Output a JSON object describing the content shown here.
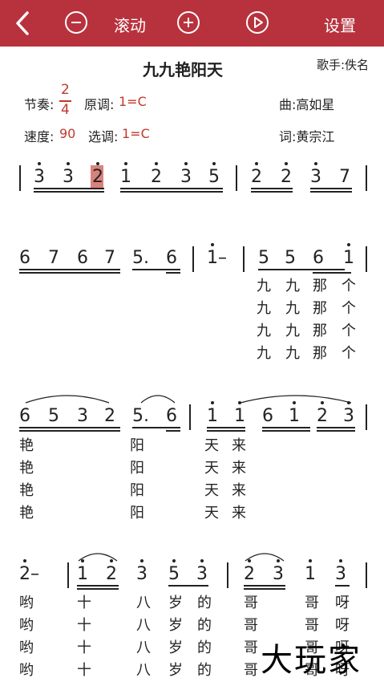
{
  "header": {
    "scroll_label": "滚动",
    "settings_label": "设置"
  },
  "song": {
    "title": "九九艳阳天",
    "singer": "歌手:佚名",
    "rhythm_label": "节奏:",
    "time_sig_top": "2",
    "time_sig_bottom": "4",
    "orig_key_label": "原调:",
    "orig_key": "1=C",
    "composer": "曲:高如星",
    "tempo_label": "速度:",
    "tempo": "90",
    "sel_key_label": "选调:",
    "sel_key": "1=C",
    "lyricist": "词:黄宗江"
  },
  "notes": {
    "r1": [
      "3",
      "3",
      "2",
      "1",
      "2",
      "3",
      "5",
      "2",
      "2",
      "3",
      "7"
    ],
    "r2": [
      "6",
      "7",
      "6",
      "7",
      "5.",
      "6",
      "1–",
      "5",
      "5",
      "6",
      "1"
    ],
    "r3": [
      "6",
      "5",
      "3",
      "2",
      "5.",
      "6",
      "1",
      "1",
      "6",
      "1",
      "2",
      "3"
    ],
    "r4": [
      "2–",
      "1",
      "2",
      "3",
      "5",
      "3",
      "2",
      "3",
      "1",
      "3"
    ]
  },
  "lyrics": {
    "r2": [
      [
        "九",
        "九",
        "那",
        "个"
      ],
      [
        "九",
        "九",
        "那",
        "个"
      ],
      [
        "九",
        "九",
        "那",
        "个"
      ],
      [
        "九",
        "九",
        "那",
        "个"
      ]
    ],
    "r3": [
      [
        "艳",
        "阳",
        "天",
        "来"
      ],
      [
        "艳",
        "阳",
        "天",
        "来"
      ],
      [
        "艳",
        "阳",
        "天",
        "来"
      ],
      [
        "艳",
        "阳",
        "天",
        "来"
      ]
    ],
    "r4": [
      [
        "哟",
        "十",
        "八",
        "岁",
        "的",
        "哥",
        "哥",
        "呀"
      ],
      [
        "哟",
        "十",
        "八",
        "岁",
        "的",
        "哥",
        "哥",
        "呀"
      ],
      [
        "哟",
        "十",
        "八",
        "岁",
        "的",
        "哥",
        "哥",
        "呀"
      ],
      [
        "哟",
        "十",
        "八",
        "岁",
        "的",
        "哥",
        "哥",
        "呀"
      ]
    ]
  },
  "watermark": "大玩家"
}
